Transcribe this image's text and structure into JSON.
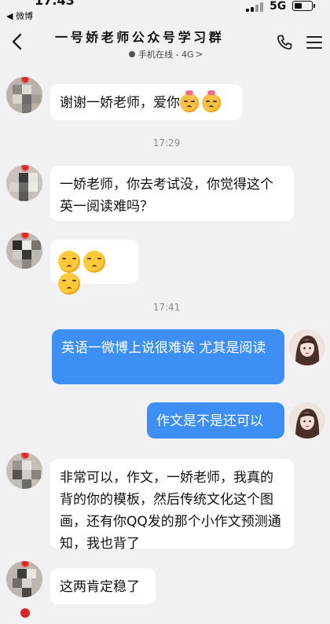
{
  "status_bar": {
    "time": "17:43",
    "back_app": "◀ 微博",
    "network": "5G",
    "battery_level": 0.45
  },
  "header": {
    "title": "一 号 娇 老 师 公 众 号 学 习 群",
    "subtitle": "手机在线 - 4G",
    "subtitle_chevron": ">"
  },
  "messages": [
    {
      "side": "in",
      "text": "谢谢一娇老师，爱你",
      "emoji_count": 2
    },
    {
      "timestamp": "17:29"
    },
    {
      "side": "in",
      "text": "一娇老师，你去考试没，你觉得这个英一阅读难吗？"
    },
    {
      "side": "in",
      "text": "",
      "emoji_count": 3
    },
    {
      "timestamp": "17:41"
    },
    {
      "side": "out",
      "text": "英语一微博上说很难诶 尤其是阅读"
    },
    {
      "side": "out",
      "text": "作文是不是还可以"
    },
    {
      "side": "in",
      "text": "非常可以，作文，一娇老师，我真的背的你的模板，然后传统文化这个图画，还有你QQ发的那个小作文预测通知，我也背了"
    },
    {
      "side": "in",
      "text": "这两肯定稳了"
    }
  ],
  "timestamps": [
    "17:29",
    "17:41"
  ],
  "colors": {
    "background": "#f1f1f3",
    "incoming_bubble": "#ffffff",
    "outgoing_bubble": "#3d8ff6",
    "timestamp_text": "#8a8a8e"
  },
  "icons": [
    "back-chevron-icon",
    "phone-icon",
    "menu-icon",
    "signal-icon",
    "battery-icon",
    "online-dot-icon"
  ]
}
